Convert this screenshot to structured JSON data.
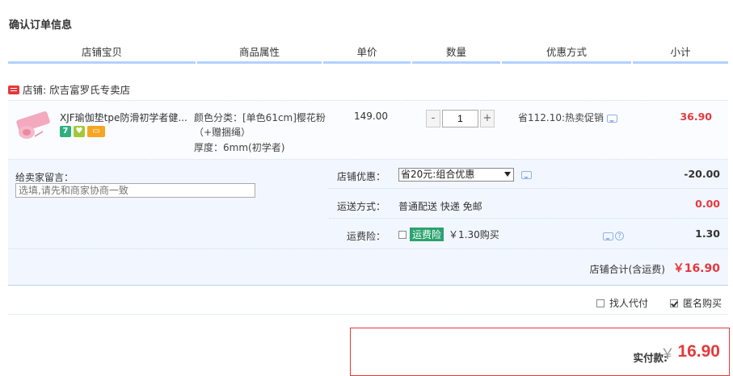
{
  "page": {
    "title": "确认订单信息"
  },
  "table_header": {
    "columns": [
      "店铺宝贝",
      "商品属性",
      "单价",
      "数量",
      "优惠方式",
      "小计"
    ]
  },
  "shop": {
    "badge_icon": "shop-badge-icon",
    "label": "店铺: 欣吉富罗氏专卖店"
  },
  "item": {
    "title": "XJF瑜伽垫tpe防滑初学者健...",
    "service_icons": [
      {
        "name": "seven-day-return-icon",
        "glyph": "7"
      },
      {
        "name": "guarantee-icon",
        "glyph": "♥"
      },
      {
        "name": "card-payment-icon",
        "glyph": "▭"
      }
    ],
    "attr_line1": "颜色分类：[单色61cm]樱花粉",
    "attr_line2": "（+赠捆绳）",
    "attr_line3": "厚度：6mm(初学者)",
    "price": "149.00",
    "qty_minus": "-",
    "qty_value": "1",
    "qty_plus": "+",
    "promo": "省112.10:热卖促销",
    "subtotal": "36.90"
  },
  "message": {
    "label": "给卖家留言：",
    "placeholder": "选填,请先和商家协商一致"
  },
  "shop_discount": {
    "label": "店铺优惠：",
    "selected": "省20元:组合优惠",
    "amount": "-20.00"
  },
  "shipping": {
    "label": "运送方式：",
    "value": "普通配送 快递 免邮",
    "amount": "0.00"
  },
  "insurance": {
    "label": "运费险：",
    "badge": "运费险",
    "price_text": "￥1.30购买",
    "amount": "1.30",
    "help_glyph": "?"
  },
  "shop_total": {
    "label": "店铺合计(含运费)",
    "value": "￥16.90"
  },
  "options": {
    "proxy_pay": "找人代付",
    "anonymous": "匿名购买"
  },
  "payment": {
    "label": "实付款:",
    "currency": "￥",
    "value": "16.90"
  },
  "colors": {
    "accent_red": "#e4393c",
    "header_bar": "#b2d1ff",
    "panel_bg": "#f2f7ff",
    "insurance_green": "#2aa36e"
  }
}
